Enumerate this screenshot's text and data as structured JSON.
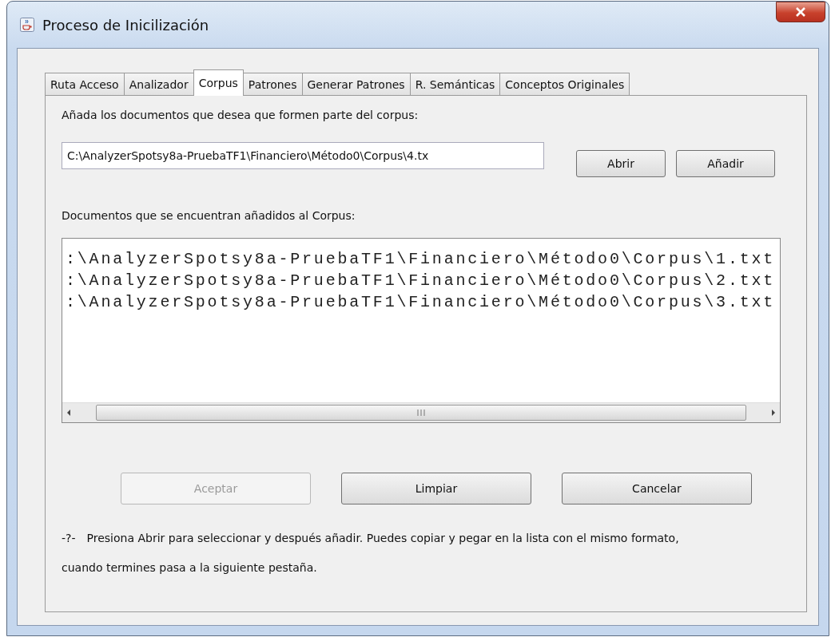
{
  "window": {
    "title": "Proceso de Inicilización"
  },
  "tabs": [
    {
      "label": "Ruta Acceso",
      "selected": false
    },
    {
      "label": "Analizador",
      "selected": false
    },
    {
      "label": "Corpus",
      "selected": true
    },
    {
      "label": "Patrones",
      "selected": false
    },
    {
      "label": "Generar Patrones",
      "selected": false
    },
    {
      "label": "R. Semánticas",
      "selected": false
    },
    {
      "label": "Conceptos Originales",
      "selected": false
    }
  ],
  "add_label": "Añada los documentos que desea que formen parte del corpus:",
  "path_field": {
    "value": "C:\\AnalyzerSpotsy8a-PruebaTF1\\Financiero\\Método0\\Corpus\\4.tx"
  },
  "field_buttons": [
    {
      "label": "Abrir",
      "disabled": false
    },
    {
      "label": "Añadir",
      "disabled": false
    }
  ],
  "list_label": "Documentos que se encuentran añadidos al Corpus:",
  "documents": [
    ":\\AnalyzerSpotsy8a-PruebaTF1\\Financiero\\Método0\\Corpus\\1.txt",
    ":\\AnalyzerSpotsy8a-PruebaTF1\\Financiero\\Método0\\Corpus\\2.txt",
    ":\\AnalyzerSpotsy8a-PruebaTF1\\Financiero\\Método0\\Corpus\\3.txt"
  ],
  "buttons": [
    {
      "label": "Aceptar",
      "disabled": true
    },
    {
      "label": "Limpiar",
      "disabled": false
    },
    {
      "label": "Cancelar",
      "disabled": false
    }
  ],
  "hint": {
    "mark": "-?-",
    "text": "Presiona Abrir para seleccionar y después añadir. Puedes copiar y pegar en la lista con el mismo formato, cuando termines pasa a la siguiente pestaña."
  }
}
